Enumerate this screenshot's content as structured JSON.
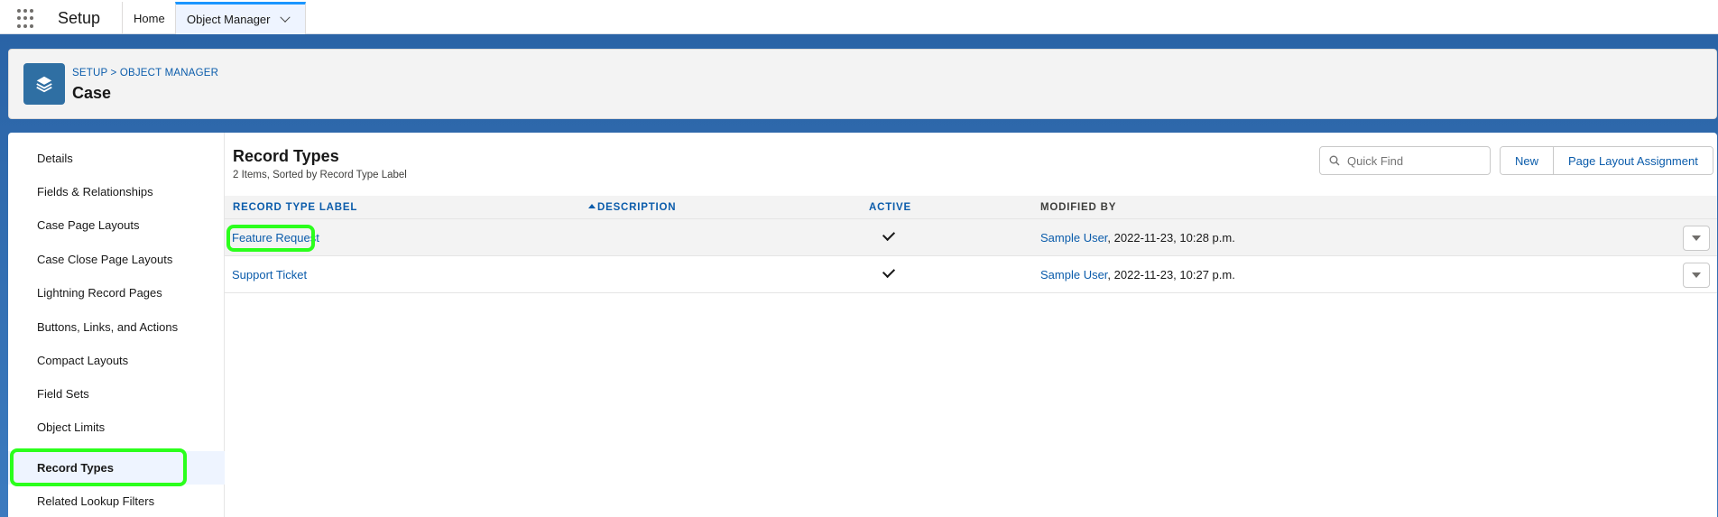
{
  "app": {
    "name": "Setup"
  },
  "nav": {
    "tabs": [
      {
        "label": "Home"
      },
      {
        "label": "Object Manager"
      }
    ]
  },
  "header": {
    "breadcrumb": "SETUP > OBJECT MANAGER",
    "title": "Case"
  },
  "sidebar": {
    "items": [
      {
        "label": "Details"
      },
      {
        "label": "Fields & Relationships"
      },
      {
        "label": "Case Page Layouts"
      },
      {
        "label": "Case Close Page Layouts"
      },
      {
        "label": "Lightning Record Pages"
      },
      {
        "label": "Buttons, Links, and Actions"
      },
      {
        "label": "Compact Layouts"
      },
      {
        "label": "Field Sets"
      },
      {
        "label": "Object Limits"
      },
      {
        "label": "Record Types"
      },
      {
        "label": "Related Lookup Filters"
      }
    ],
    "active": "Record Types"
  },
  "main": {
    "title": "Record Types",
    "subtitle": "2 Items, Sorted by Record Type Label",
    "search_placeholder": "Quick Find",
    "buttons": {
      "new": "New",
      "page_layout_assignment": "Page Layout Assignment"
    },
    "columns": {
      "label": "RECORD TYPE LABEL",
      "description": "DESCRIPTION",
      "active": "ACTIVE",
      "modified_by": "MODIFIED BY"
    },
    "rows": [
      {
        "label": "Feature Request",
        "description": "",
        "active": true,
        "modified_user": "Sample User",
        "modified_date": ", 2022-11-23, 10:28 p.m."
      },
      {
        "label": "Support Ticket",
        "description": "",
        "active": true,
        "modified_user": "Sample User",
        "modified_date": ", 2022-11-23, 10:27 p.m."
      }
    ]
  },
  "icons": [
    "app-launcher-icon",
    "chevron-down-icon",
    "layers-icon",
    "search-icon",
    "sort-ascending-icon",
    "checkmark-icon",
    "row-actions-icon"
  ],
  "colors": {
    "brand_blue": "#2e66a8",
    "link": "#0b5cab",
    "highlight": "#2bff1c"
  }
}
